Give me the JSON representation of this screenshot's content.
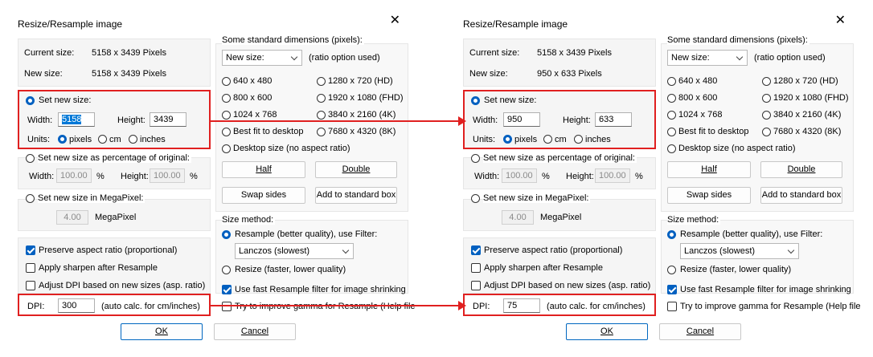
{
  "dialogs": [
    {
      "title": "Resize/Resample image",
      "current_size_label": "Current size:",
      "current_size_value": "5158  x  3439  Pixels",
      "new_size_label": "New size:",
      "new_size_value": "5158  x  3439  Pixels",
      "set_new_size_label": "Set new size:",
      "width_label": "Width:",
      "width_value": "5158",
      "height_label": "Height:",
      "height_value": "3439",
      "units_label": "Units:",
      "unit_pixels": "pixels",
      "unit_cm": "cm",
      "unit_inches": "inches",
      "pct_label": "Set new size as percentage of original:",
      "pct_width_label": "Width:",
      "pct_width_value": "100.00",
      "pct_height_label": "Height:",
      "pct_height_value": "100.00",
      "pct_unit": "%",
      "mp_label": "Set new size in MegaPixel:",
      "mp_value": "4.00",
      "mp_unit": "MegaPixel",
      "preserve_label": "Preserve aspect ratio (proportional)",
      "sharpen_label": "Apply sharpen after Resample",
      "adjust_dpi_label": "Adjust DPI based on new sizes (asp. ratio)",
      "dpi_label": "DPI:",
      "dpi_value": "300",
      "dpi_note": "(auto calc. for cm/inches)",
      "std_dims_label": "Some standard dimensions (pixels):",
      "new_size_dropdown": "New size:",
      "ratio_note": "(ratio option used)",
      "dims": [
        "640 x 480",
        "1280 x 720  (HD)",
        "800 x 600",
        "1920 x 1080 (FHD)",
        "1024 x 768",
        "3840 x 2160 (4K)",
        "Best fit to desktop",
        "7680 x 4320 (8K)"
      ],
      "desktop_size": "Desktop size (no aspect ratio)",
      "half": "Half",
      "double": "Double",
      "swap": "Swap sides",
      "add_std": "Add to standard box",
      "size_method_label": "Size method:",
      "resample_label": "Resample (better quality), use Filter:",
      "filter_value": "Lanczos (slowest)",
      "resize_label": "Resize (faster, lower quality)",
      "fast_resample_label": "Use fast Resample filter for image shrinking",
      "gamma_label": "Try to improve gamma for Resample (Help file",
      "ok": "OK",
      "cancel": "Cancel"
    },
    {
      "title": "Resize/Resample image",
      "current_size_label": "Current size:",
      "current_size_value": "5158  x  3439  Pixels",
      "new_size_label": "New size:",
      "new_size_value": "950  x  633  Pixels",
      "set_new_size_label": "Set new size:",
      "width_label": "Width:",
      "width_value": "950",
      "height_label": "Height:",
      "height_value": "633",
      "units_label": "Units:",
      "unit_pixels": "pixels",
      "unit_cm": "cm",
      "unit_inches": "inches",
      "pct_label": "Set new size as percentage of original:",
      "pct_width_label": "Width:",
      "pct_width_value": "100.00",
      "pct_height_label": "Height:",
      "pct_height_value": "100.00",
      "pct_unit": "%",
      "mp_label": "Set new size in MegaPixel:",
      "mp_value": "4.00",
      "mp_unit": "MegaPixel",
      "preserve_label": "Preserve aspect ratio (proportional)",
      "sharpen_label": "Apply sharpen after Resample",
      "adjust_dpi_label": "Adjust DPI based on new sizes (asp. ratio)",
      "dpi_label": "DPI:",
      "dpi_value": "75",
      "dpi_note": "(auto calc. for cm/inches)",
      "std_dims_label": "Some standard dimensions (pixels):",
      "new_size_dropdown": "New size:",
      "ratio_note": "(ratio option used)",
      "dims": [
        "640 x 480",
        "1280 x 720  (HD)",
        "800 x 600",
        "1920 x 1080 (FHD)",
        "1024 x 768",
        "3840 x 2160 (4K)",
        "Best fit to desktop",
        "7680 x 4320 (8K)"
      ],
      "desktop_size": "Desktop size (no aspect ratio)",
      "half": "Half",
      "double": "Double",
      "swap": "Swap sides",
      "add_std": "Add to standard box",
      "size_method_label": "Size method:",
      "resample_label": "Resample (better quality), use Filter:",
      "filter_value": "Lanczos (slowest)",
      "resize_label": "Resize (faster, lower quality)",
      "fast_resample_label": "Use fast Resample filter for image shrinking",
      "gamma_label": "Try to improve gamma for Resample (Help file",
      "ok": "OK",
      "cancel": "Cancel"
    }
  ],
  "colors": {
    "highlight": "#e02020",
    "accent": "#0060c0"
  }
}
